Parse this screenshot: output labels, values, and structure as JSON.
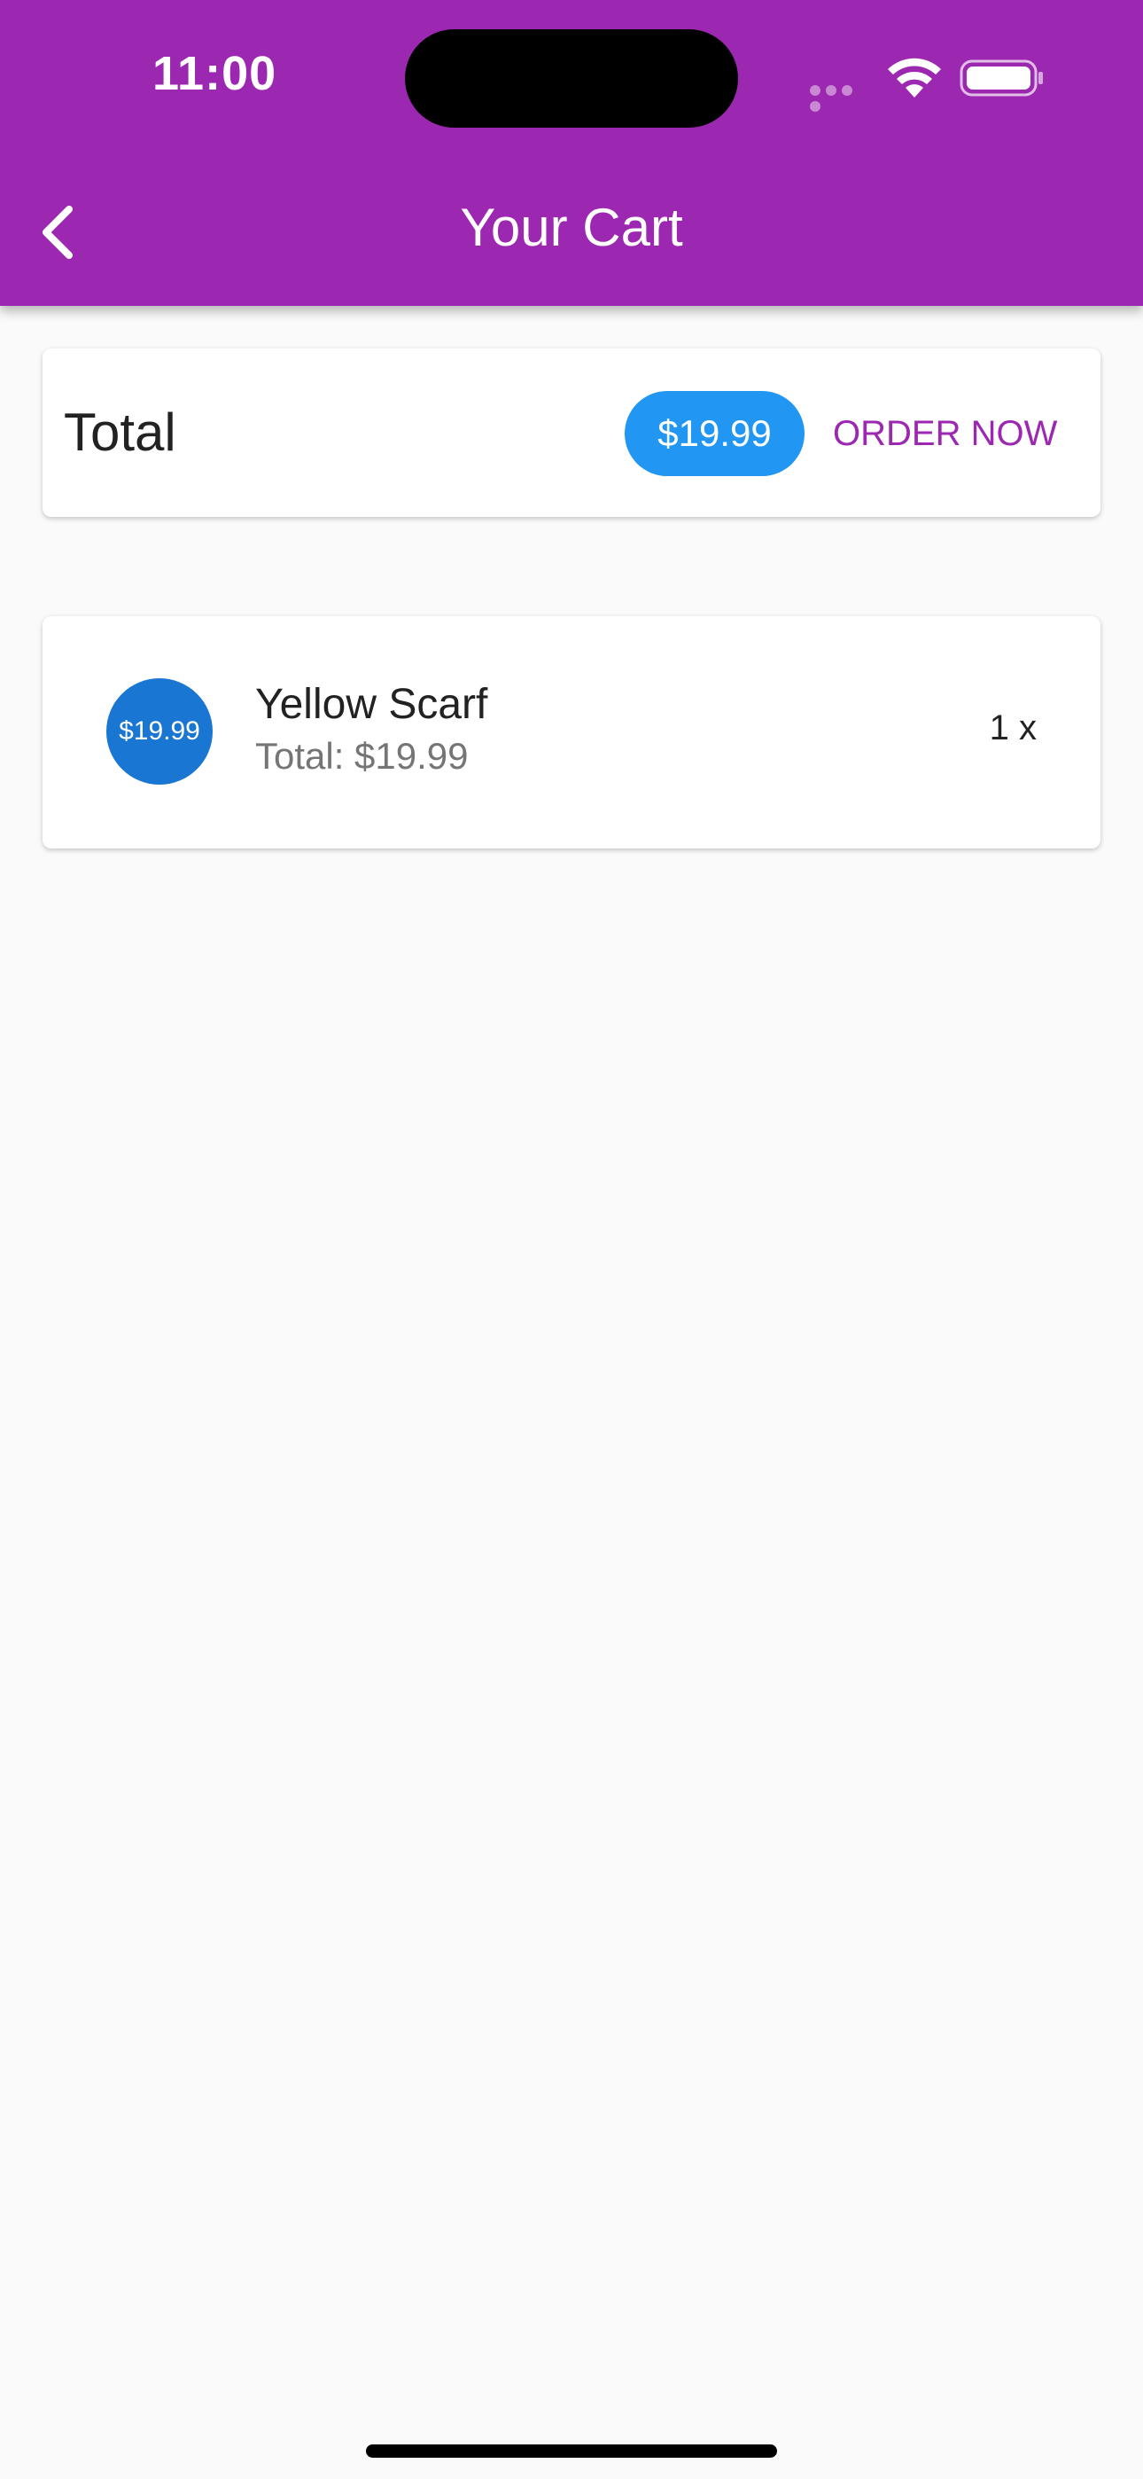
{
  "status_bar": {
    "time": "11:00",
    "icons": [
      "signal-icon",
      "wifi-icon",
      "battery-icon"
    ]
  },
  "app_bar": {
    "back_icon": "chevron-left-icon",
    "title": "Your Cart",
    "background_color": "#9c27b0"
  },
  "total_card": {
    "label": "Total",
    "amount": "$19.99",
    "amount_chip_color": "#2196f3",
    "order_button_label": "ORDER NOW",
    "order_button_color": "#9c27b0"
  },
  "cart_items": [
    {
      "avatar_text": "$19.99",
      "avatar_color": "#1976d2",
      "title": "Yellow Scarf",
      "subtitle": "Total: $19.99",
      "quantity": "1 x"
    }
  ]
}
